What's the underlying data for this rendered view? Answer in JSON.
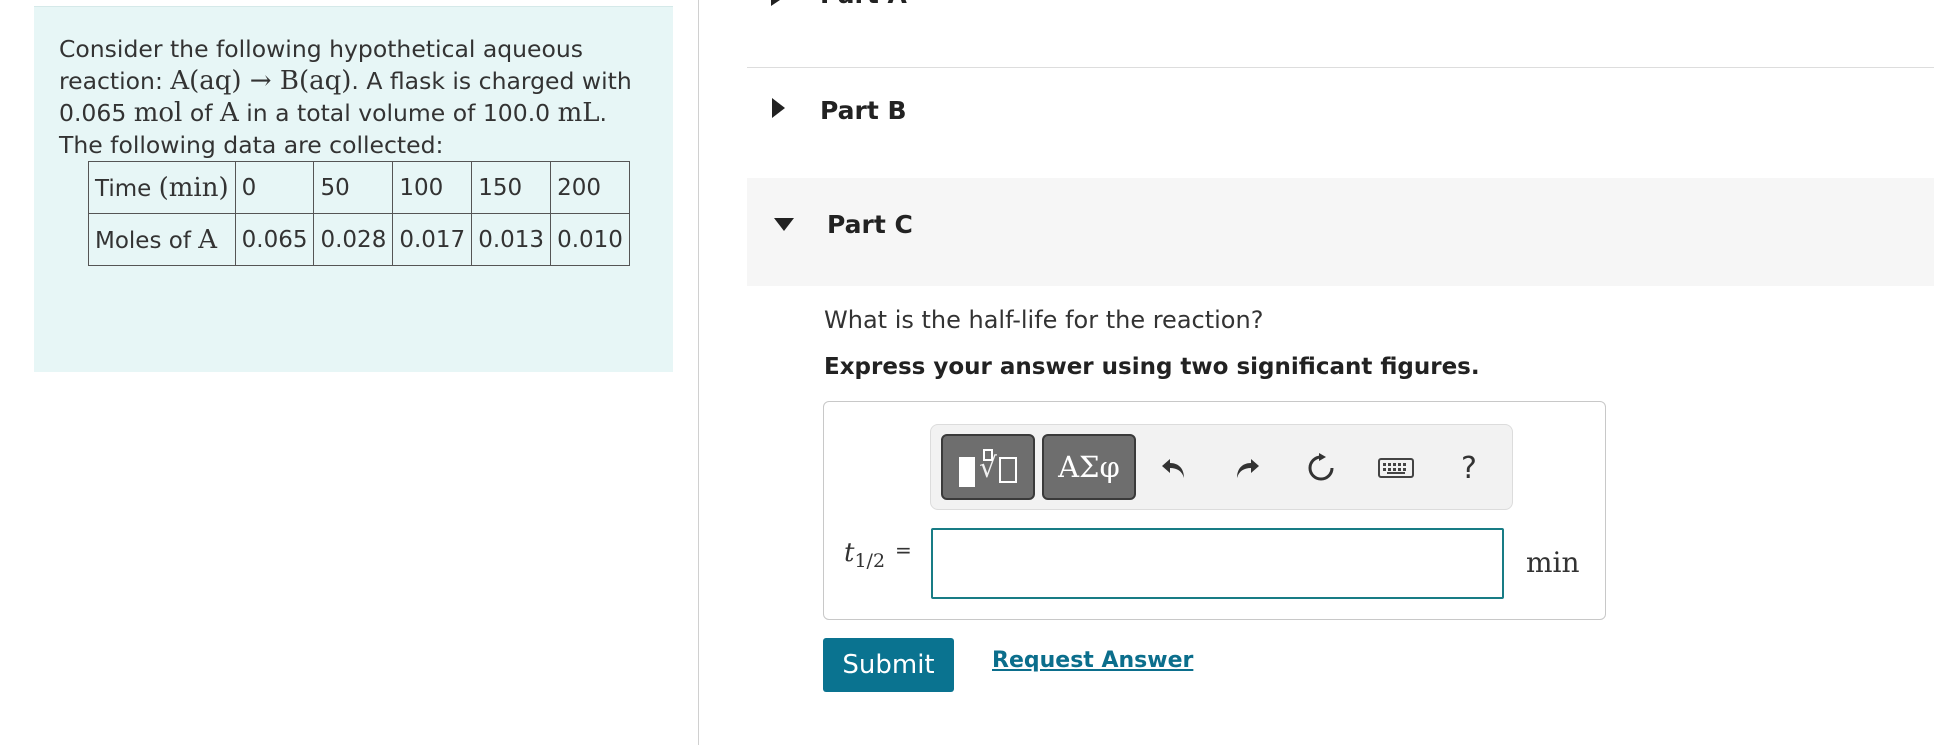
{
  "problem": {
    "intro": "Consider the following hypothetical aqueous reaction: ",
    "reaction": "A(aq) → B(aq)",
    "sentence2_a": ". A flask is charged with 0.065 ",
    "unit_mol": "mol",
    "sentence2_b": " of ",
    "species_a": "A",
    "sentence2_c": " in a total volume of 100.0 ",
    "unit_ml": "mL",
    "sentence2_d": ". The following data are collected:",
    "table": {
      "row1_label": "Time ",
      "row1_unit": "(min)",
      "times": [
        "0",
        "50",
        "100",
        "150",
        "200"
      ],
      "row2_label": "Moles of ",
      "row2_species": "A",
      "moles": [
        "0.065",
        "0.028",
        "0.017",
        "0.013",
        "0.010"
      ]
    }
  },
  "parts": {
    "part_a": "Part A",
    "part_b": "Part B",
    "part_c": "Part C"
  },
  "part_c": {
    "question": "What is the half-life for the reaction?",
    "instruction": "Express your answer using two significant figures.",
    "toolbar": {
      "greek_label": "ΑΣφ",
      "help_label": "?"
    },
    "variable": "t",
    "variable_sub": "1/2",
    "equals": "=",
    "answer_value": "",
    "unit": "min",
    "submit_label": "Submit",
    "request_label": "Request Answer"
  }
}
